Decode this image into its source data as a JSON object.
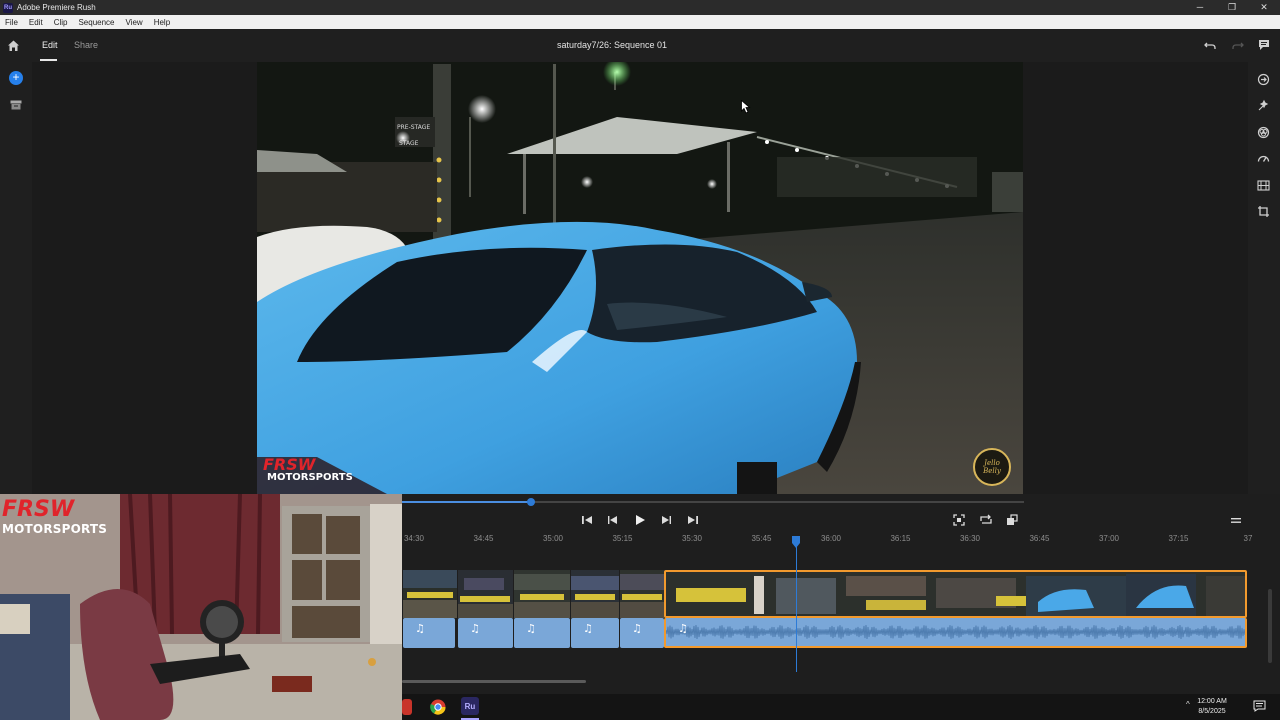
{
  "window": {
    "title": "Adobe Premiere Rush",
    "app_badge": "Ru",
    "controls": [
      "─",
      "❐",
      "✕"
    ]
  },
  "menu": [
    "File",
    "Edit",
    "Clip",
    "Sequence",
    "View",
    "Help"
  ],
  "header": {
    "tabs": [
      {
        "label": "Edit",
        "active": true
      },
      {
        "label": "Share",
        "active": false
      }
    ],
    "sequence_title": "saturday7/26: Sequence 01",
    "icons": [
      "home-icon",
      "undo-icon",
      "redo-icon",
      "comment-icon"
    ]
  },
  "left_rail": {
    "add_label": "+",
    "icons": [
      "add-media-icon",
      "media-library-icon"
    ]
  },
  "right_rail": {
    "icons": [
      "transitions-icon",
      "effects-icon",
      "color-icon",
      "speed-icon",
      "audio-icon",
      "transform-icon"
    ]
  },
  "video": {
    "watermark": "MOTORSPORTS",
    "corner_logo": "Jello Belly"
  },
  "webcam": {
    "logo": "MOTORSPORTS"
  },
  "timeline": {
    "ruler_ticks": [
      "34:30",
      "34:45",
      "35:00",
      "35:15",
      "35:30",
      "35:45",
      "36:00",
      "36:15",
      "36:30",
      "36:45",
      "37:00",
      "37:15",
      "37"
    ],
    "scrub_progress": 0.208,
    "playhead_time_fraction": 0.5,
    "audio_glyph": "♫",
    "transport": [
      "skip-back-icon",
      "step-back-icon",
      "play-icon",
      "step-forward-icon",
      "skip-forward-icon"
    ],
    "view_controls": [
      "fit-icon",
      "loop-icon",
      "fullscreen-icon"
    ]
  },
  "taskbar": {
    "app_badge": "Ru",
    "time": "12:00 AM",
    "date": "8/5/2025",
    "chevron": "^"
  },
  "colors": {
    "accent_blue": "#2680eb",
    "selection_orange": "#f29a2e",
    "audio_blue": "#7aa7d8"
  }
}
